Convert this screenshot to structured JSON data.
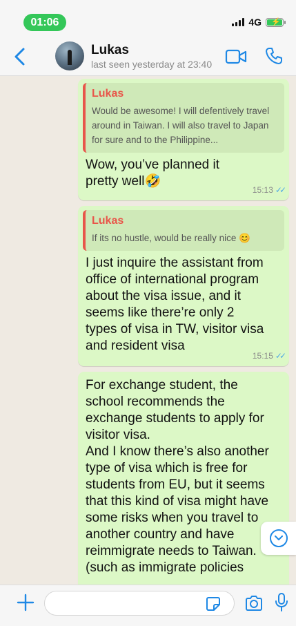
{
  "status_bar": {
    "time": "01:06",
    "network": "4G",
    "icons": [
      "signal-icon",
      "battery-charging-icon"
    ]
  },
  "header": {
    "contact_name": "Lukas",
    "last_seen": "last seen yesterday at 23:40",
    "icons": [
      "back-chevron-icon",
      "video-camera-icon",
      "phone-icon"
    ]
  },
  "messages": [
    {
      "quote_author": "Lukas",
      "quote_text": "Would be awesome! I will defentively travel around in Taiwan. I will also travel to Japan for sure and to the Philippine...",
      "text": "Wow, you’ve planned it pretty well🤣",
      "time": "15:13",
      "read": true
    },
    {
      "quote_author": "Lukas",
      "quote_text": "If its no hustle, would be really nice 😊",
      "text": "I just inquire the assistant from office of international program about the visa issue, and it seems like there’re only 2 types of visa in TW, visitor visa and resident visa",
      "time": "15:15",
      "read": true
    },
    {
      "text": "For exchange student, the school recommends the exchange students to apply for visitor visa.\nAnd I know there’s also another type of visa which is free for students from EU, but it seems that this kind of visa might have some risks when you travel to another country and have reimmigrate needs to Taiwan.\n(such as immigrate policies"
    }
  ],
  "input_bar": {
    "placeholder": "",
    "icons": [
      "plus-icon",
      "sticker-icon",
      "camera-icon",
      "microphone-icon"
    ]
  },
  "colors": {
    "accent": "#1e88e5",
    "bubble_out": "#dcf8c6",
    "quote_author": "#e8564a",
    "read_ticks": "#4fa9e6",
    "time_pill": "#34c759"
  }
}
